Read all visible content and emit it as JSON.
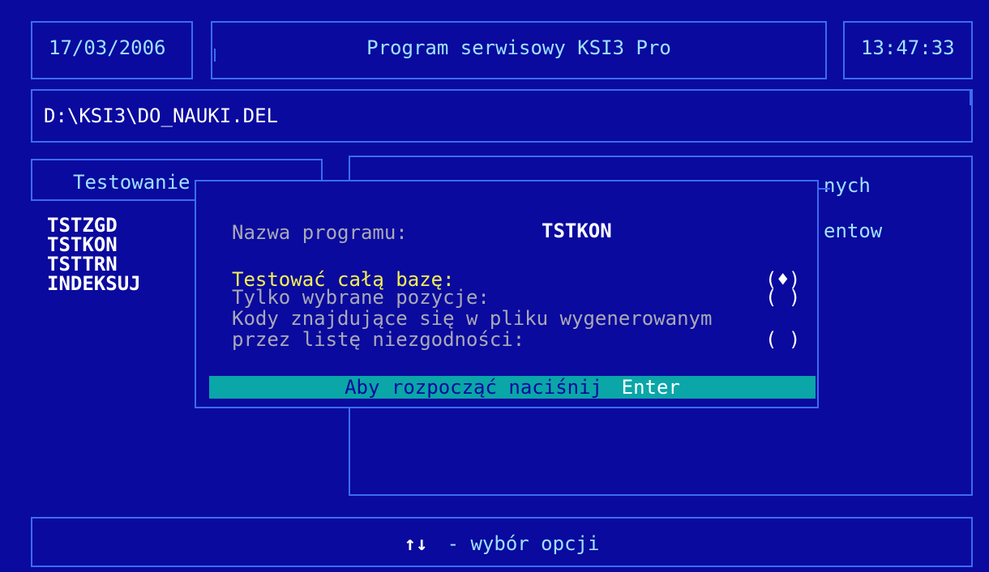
{
  "header": {
    "date": "17/03/2006",
    "title": "Program serwisowy KSI3 Pro",
    "time": "13:47:33"
  },
  "path_bar": {
    "path": "D:\\KSI3\\DO_NAUKI.DEL"
  },
  "left_panel": {
    "title": "Testowanie",
    "items": [
      "TSTZGD",
      "TSTKON",
      "TSTTRN",
      "INDEKSUJ"
    ]
  },
  "right_panel": {
    "line1_fragment": "nych",
    "line2_fragment": "entow"
  },
  "dialog": {
    "program_label": "Nazwa programu:",
    "program_value": "TSTKON",
    "options": [
      {
        "label": "Testować całą bazę:",
        "mark": "(♦)",
        "selected": true
      },
      {
        "label": "Tylko wybrane pozycje:",
        "mark": "( )",
        "selected": false
      },
      {
        "label": "Kody znajdujące się w pliku wygenerowanym\nprzez listę niezgodności:",
        "mark": "( )",
        "selected": false
      }
    ],
    "action_prefix": "Aby rozpocząć naciśnij",
    "action_key": "Enter"
  },
  "footer": {
    "hint_arrows": "↑↓",
    "hint_text": " - wybór opcji"
  },
  "colors": {
    "background": "#0a0a9e",
    "border": "#3c6cf0",
    "text_cyan": "#9fe0ff",
    "text_gray": "#a9a9b6",
    "text_yellow": "#f4ef55",
    "action_bar": "#0aa6a8"
  }
}
